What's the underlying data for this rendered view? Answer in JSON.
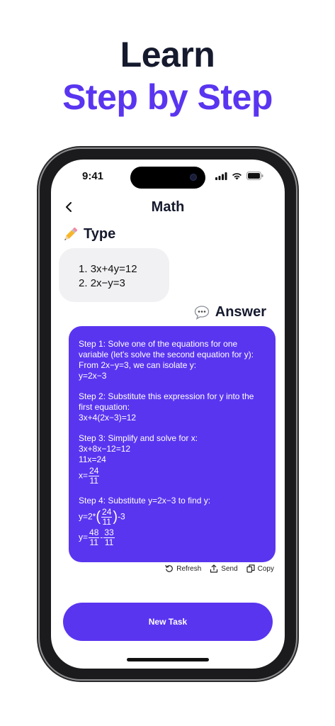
{
  "headline": {
    "line1": "Learn",
    "line2": "Step by Step"
  },
  "status_bar": {
    "time": "9:41"
  },
  "nav": {
    "title": "Math"
  },
  "type_section": {
    "label": "Type",
    "items": [
      "3x+4y=12",
      "2x−y=3"
    ]
  },
  "answer_section": {
    "label": "Answer",
    "step1": {
      "line1": "Step 1: Solve one of the equations for one variable (let's solve the second equation for y):",
      "line2": "From 2x−y=3, we can isolate y:",
      "line3": "y=2x−3"
    },
    "step2": {
      "line1": "Step 2: Substitute this expression for y into the first equation:",
      "line2": "3x+4(2x−3)=12"
    },
    "step3": {
      "line1": "Step 3: Simplify and solve for x:",
      "line2": "3x+8x−12=12",
      "line3": "11x=24",
      "x_prefix": "x=",
      "x_num": "24",
      "x_den": "11"
    },
    "step4": {
      "line1": "Step 4: Substitute y=2x−3 to find y:",
      "y1_prefix": "y=2*",
      "y1_num": "24",
      "y1_den": "11",
      "y1_suffix": "-3",
      "y2_prefix": "y=",
      "y2_num_a": "48",
      "y2_den_a": "11",
      "y2_minus": "-",
      "y2_num_b": "33",
      "y2_den_b": "11"
    }
  },
  "actions": {
    "refresh": "Refresh",
    "send": "Send",
    "copy": "Copy"
  },
  "cta": {
    "label": "New Task"
  },
  "icons": {
    "type": "pencil-icon",
    "answer": "speech-bubble-icon",
    "back": "chevron-left-icon",
    "refresh": "refresh-icon",
    "send": "upload-icon",
    "copy": "copy-icon"
  },
  "colors": {
    "accent": "#5a35f0",
    "dark_text": "#161a2e",
    "bubble_gray": "#f1f1f3"
  }
}
